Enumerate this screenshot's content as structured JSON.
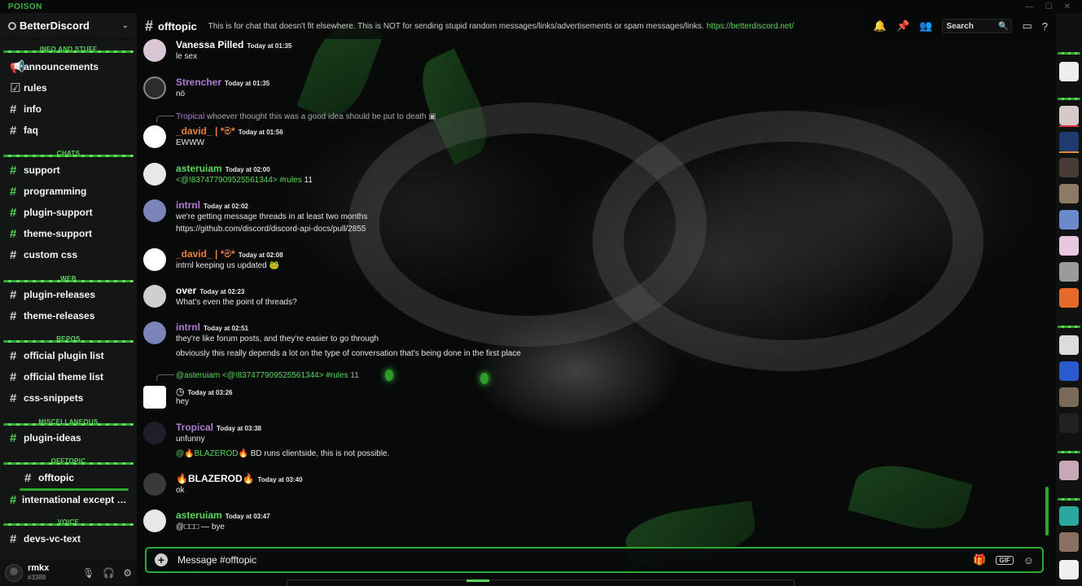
{
  "titlebar": {
    "brand": "POISON"
  },
  "server": {
    "name": "BetterDiscord"
  },
  "categories": {
    "info": "INFO AND STUFF",
    "chats": "CHATS",
    "web": "WEB",
    "repos": "REPOS",
    "misc": "MISCELLANEOUS",
    "offtopic": "OFFTOPIC",
    "voice": "VOICE"
  },
  "channels": [
    {
      "name": "announcements",
      "icon": "megaphone-icon"
    },
    {
      "name": "rules",
      "icon": "checkbox-icon"
    },
    {
      "name": "info",
      "icon": "hash-icon"
    },
    {
      "name": "faq",
      "icon": "hash-icon"
    },
    {
      "name": "support",
      "icon": "hash-icon"
    },
    {
      "name": "programming",
      "icon": "hash-icon"
    },
    {
      "name": "plugin-support",
      "icon": "hash-icon"
    },
    {
      "name": "theme-support",
      "icon": "hash-icon"
    },
    {
      "name": "custom css",
      "icon": "hash-icon"
    },
    {
      "name": "plugin-releases",
      "icon": "hash-icon"
    },
    {
      "name": "theme-releases",
      "icon": "hash-icon"
    },
    {
      "name": "official plugin list",
      "icon": "hash-icon"
    },
    {
      "name": "official theme list",
      "icon": "hash-icon"
    },
    {
      "name": "css-snippets",
      "icon": "hash-icon"
    },
    {
      "name": "plugin-ideas",
      "icon": "hash-icon"
    },
    {
      "name": "offtopic",
      "icon": "hash-icon",
      "active": true
    },
    {
      "name": "international except engli...",
      "icon": "hash-icon"
    },
    {
      "name": "devs-vc-text",
      "icon": "hash-icon"
    }
  ],
  "user": {
    "name": "rmkx",
    "tag": "#3388"
  },
  "header": {
    "channel": "offtopic",
    "topic": "This is for chat that doesn't fit elsewhere. This is NOT for sending stupid random messages/links/advertisements or spam messages/links.",
    "link": "https://betterdiscord.net/",
    "search_placeholder": "Search"
  },
  "messages": [
    {
      "author": "Vanessa Pilled",
      "time": "Today at 01:35",
      "lines": [
        "le sex"
      ]
    },
    {
      "author": "Strencher",
      "time": "Today at 01:35",
      "lines": [
        "nö"
      ]
    },
    {
      "reply_author": "Tropical",
      "reply_text": "whoever thought this was a good idea should be put to death",
      "author": "_david_ | *ම*",
      "time": "Today at 01:56",
      "lines": [
        "EWWW"
      ]
    },
    {
      "author": "asteruiam",
      "time": "Today at 02:00",
      "mention": "<@!837477909525561344>",
      "channel_ref": "#rules",
      "suffix": "11"
    },
    {
      "author": "intrnl",
      "time": "Today at 02:02",
      "lines": [
        "we're getting message threads in at least two months"
      ],
      "link": "https://github.com/discord/discord-api-docs/pull/2855"
    },
    {
      "author": "_david_ | *ම*",
      "time": "Today at 02:08",
      "lines": [
        "intrnl keeping us updated"
      ]
    },
    {
      "author": "over",
      "time": "Today at 02:23",
      "lines": [
        "What's even the point of threads?"
      ]
    },
    {
      "author": "intrnl",
      "time": "Today at 02:51",
      "lines": [
        "they're like forum posts, and they're easier to go through",
        "obviously this really depends a lot on the type of conversation that's being done in the first place"
      ]
    },
    {
      "reply_author": "@asteruiam",
      "reply_mention": "<@!837477909525561344>",
      "reply_channel": "#rules",
      "reply_suffix": "11",
      "author": "",
      "time": "Today at 03:26",
      "lines": [
        "hey"
      ]
    },
    {
      "author": "Tropical",
      "time": "Today at 03:38",
      "lines": [
        "unfunny"
      ],
      "mention_line": "@🔥BLAZEROD🔥",
      "mention_rest": "BD runs clientside, this is not possible."
    },
    {
      "author": "🔥BLAZEROD🔥",
      "time": "Today at 03:40",
      "lines": [
        "ok"
      ]
    },
    {
      "author": "asteruiam",
      "time": "Today at 03:47",
      "lines": [
        "@□□□ — bye"
      ]
    }
  ],
  "composer": {
    "placeholder": "Message #offtopic",
    "gif_label": "GIF"
  },
  "colors": {
    "accent": "#2fa82f",
    "accent_light": "#5cd65c",
    "purple": "#b07bd0"
  },
  "icons": [
    "bell-icon",
    "pin-icon",
    "members-icon",
    "search-icon",
    "inbox-icon",
    "help-icon",
    "mic-icon",
    "headphones-icon",
    "gear-icon",
    "gift-icon",
    "emoji-icon",
    "plus-icon"
  ]
}
